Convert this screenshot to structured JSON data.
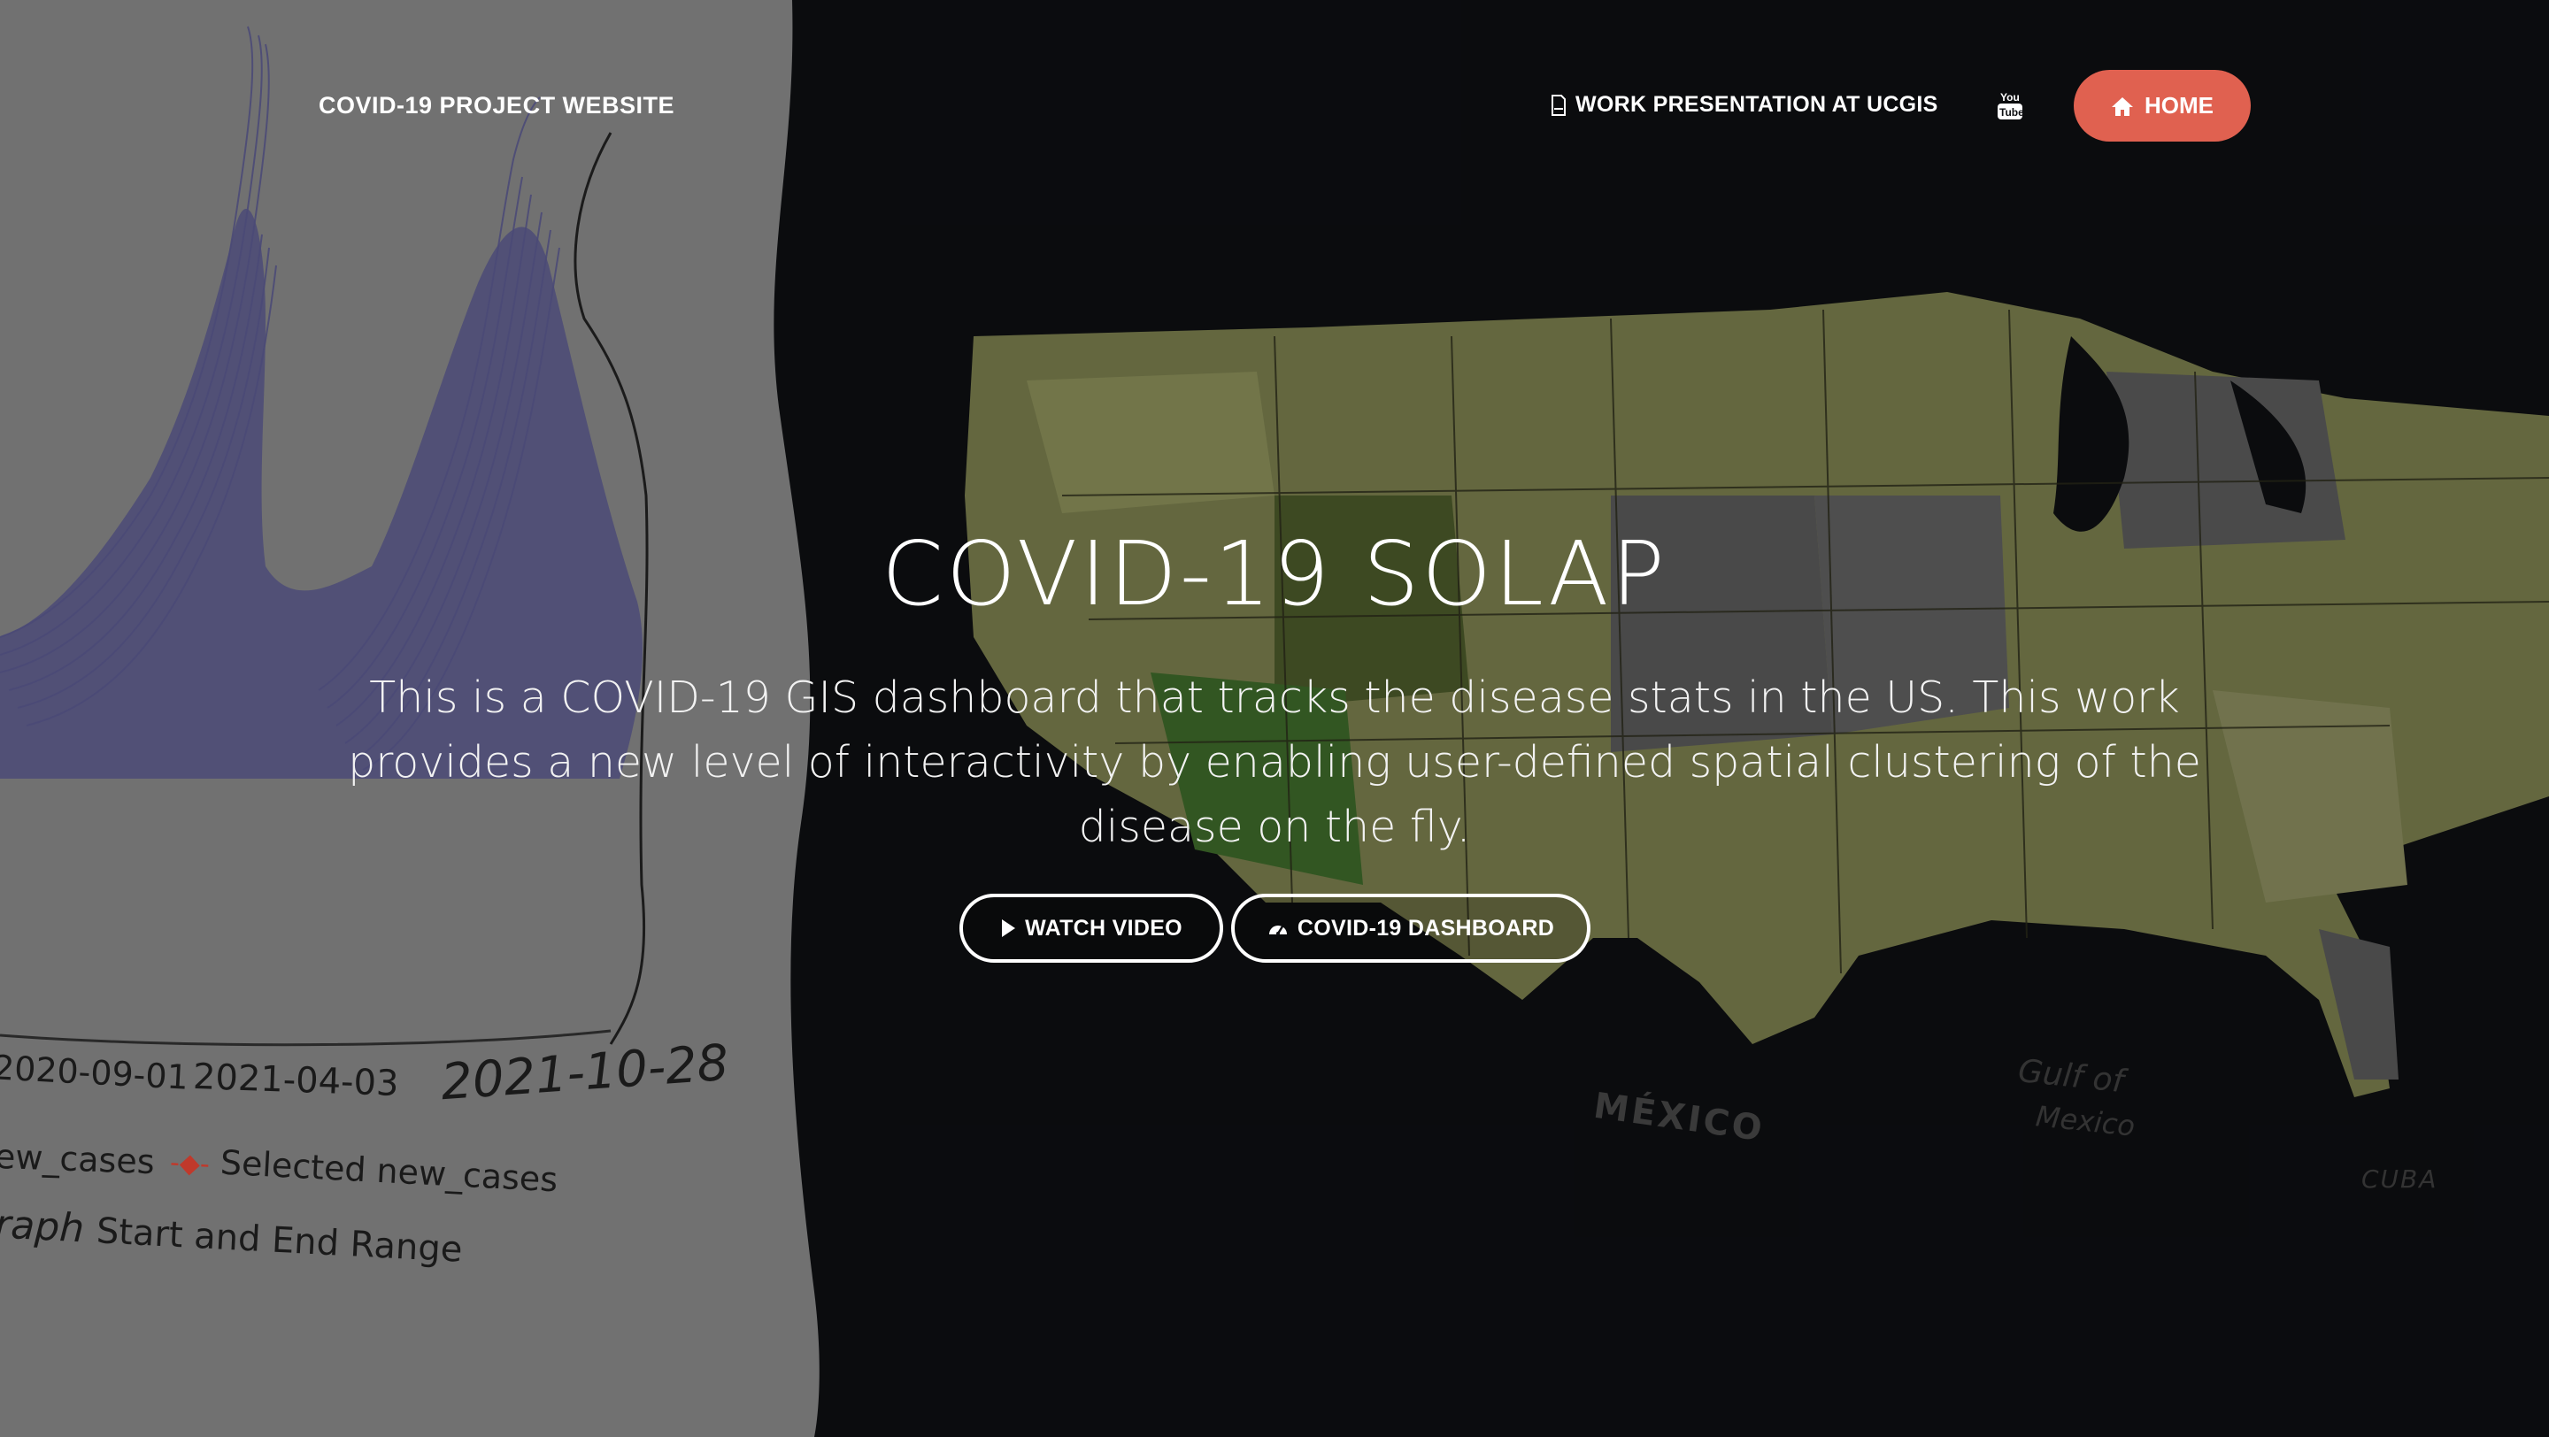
{
  "nav": {
    "brand": "COVID-19 PROJECT WEBSITE",
    "work_link": "WORK PRESENTATION AT UCGIS",
    "youtube_icon": "youtube-icon",
    "home_label": "HOME"
  },
  "hero": {
    "title": "COVID-19 SOLAP",
    "description": "This is a COVID-19 GIS dashboard that tracks the disease stats in the US. This work provides a new level of interactivity by enabling user-defined spatial clustering of the disease on the fly.",
    "watch_video": "WATCH VIDEO",
    "dashboard": "COVID-19 DASHBOARD"
  },
  "background_chart": {
    "tick1": "2020-09-01",
    "tick2": "2021-04-03",
    "tick3": "2021-10-28",
    "legend_1": "ew_cases",
    "legend_2": "Selected new_cases",
    "range_label_a": "raph",
    "range_label_b": "Start and End Range"
  },
  "map_labels": {
    "mexico": "MÉXICO",
    "gulf": "Gulf of",
    "gulf2": "Mexico",
    "cuba": "CUBA"
  },
  "colors": {
    "accent": "#e06150",
    "background": "#0e0f12",
    "panel": "#8a8a8a",
    "series": "#5a5a8e"
  }
}
